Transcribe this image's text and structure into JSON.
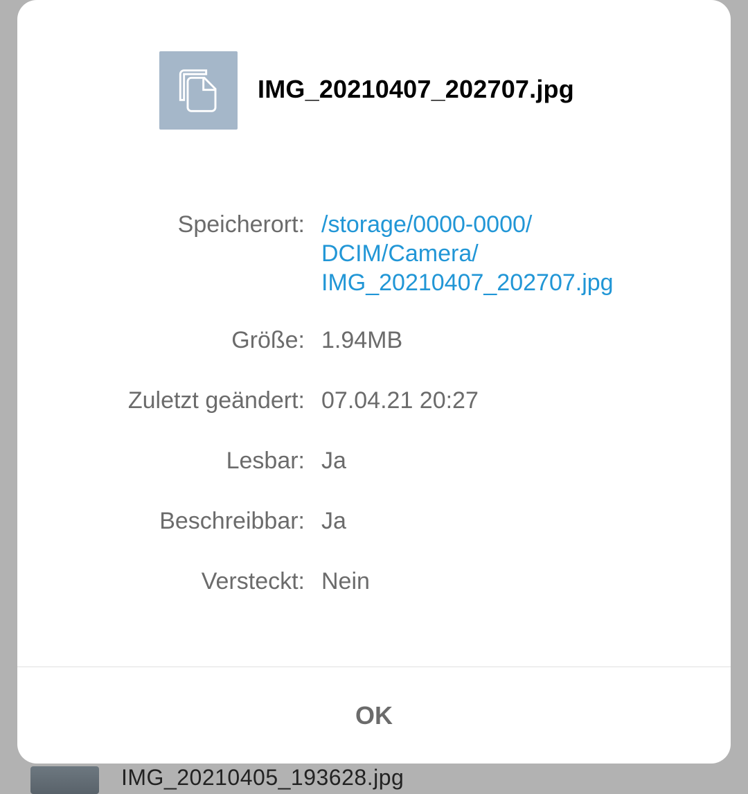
{
  "background": {
    "list_item_filename": "IMG_20210405_193628.jpg"
  },
  "dialog": {
    "file_name": "IMG_20210407_202707.jpg",
    "icon": "copy-icon",
    "properties": [
      {
        "label": "Speicherort:",
        "value_lines": [
          "/storage/0000-0000/",
          "DCIM/Camera/",
          "IMG_20210407_202707.jpg"
        ],
        "is_link": true
      },
      {
        "label": "Größe:",
        "value": "1.94MB"
      },
      {
        "label": "Zuletzt geändert:",
        "value": "07.04.21 20:27"
      },
      {
        "label": "Lesbar:",
        "value": "Ja"
      },
      {
        "label": "Beschreibbar:",
        "value": "Ja"
      },
      {
        "label": "Versteckt:",
        "value": "Nein"
      }
    ],
    "ok_label": "OK"
  },
  "colors": {
    "link": "#2196d6",
    "icon_bg": "#a5b7c9",
    "scrim": "#b2b2b2"
  }
}
